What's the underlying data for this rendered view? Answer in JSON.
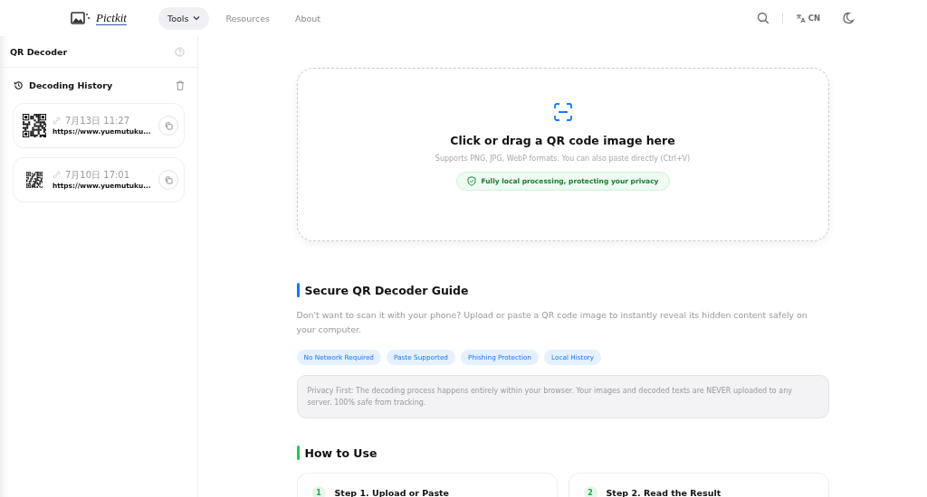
{
  "header": {
    "logo": "Pictkit",
    "nav": [
      {
        "label": "Tools",
        "selected": true,
        "dropdown": true
      },
      {
        "label": "Resources",
        "selected": false,
        "dropdown": false
      },
      {
        "label": "About",
        "selected": false,
        "dropdown": false
      }
    ],
    "language": "CN"
  },
  "sidebar": {
    "title": "QR Decoder",
    "history_title": "Decoding History",
    "history": [
      {
        "time": "7月13日 11:27",
        "url": "https://www.yuemutuku..."
      },
      {
        "time": "7月10日 17:01",
        "url": "https://www.yuemutuku..."
      }
    ]
  },
  "upload": {
    "title": "Click or drag a QR code image here",
    "hint": "Supports PNG, JPG, WebP formats. You can also paste directly (Ctrl+V)",
    "badge": "Fully local processing, protecting your privacy"
  },
  "guide": {
    "title": "Secure QR Decoder Guide",
    "color": "#1677ff",
    "description": "Don't want to scan it with your phone? Upload or paste a QR code image to instantly reveal its hidden content safely on your computer.",
    "tags": [
      "No Network Required",
      "Paste Supported",
      "Phishing Protection",
      "Local History"
    ],
    "note": "Privacy First: The decoding process happens entirely within your browser. Your images and decoded texts are NEVER uploaded to any server. 100% safe from tracking."
  },
  "how_to": {
    "title": "How to Use",
    "color": "#22c55e",
    "steps": [
      {
        "number": "1",
        "title": "Step 1. Upload or Paste"
      },
      {
        "number": "2",
        "title": "Step 2. Read the Result"
      }
    ]
  }
}
